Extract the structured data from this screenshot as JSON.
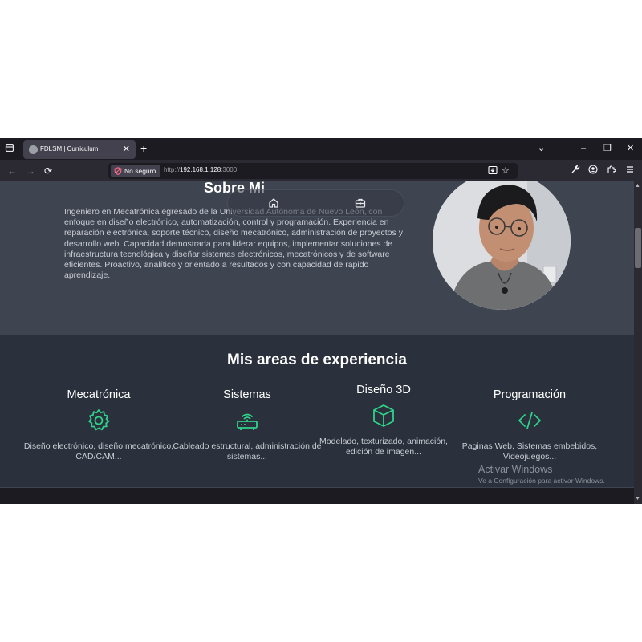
{
  "browser": {
    "tab": {
      "title": "FDLSM | Curriculum",
      "close": "✕"
    },
    "new_tab": "+",
    "window_controls": {
      "list_tabs": "⌄",
      "minimize": "–",
      "restore": "❐",
      "close": "✕"
    },
    "nav": {
      "back": "←",
      "forward": "→",
      "reload": "⟳"
    },
    "security_label": "No seguro",
    "url": {
      "scheme": "http://",
      "host": "192.168.1.128",
      "port": ":3000"
    },
    "toolbar_icons": [
      "reader-view-icon",
      "bookmark-star-icon",
      "tools-icon",
      "account-icon",
      "extensions-icon",
      "menu-icon"
    ]
  },
  "about": {
    "title": "Sobre Mi",
    "description": "Ingeniero en Mecatrónica egresado de la Universidad Autónoma de Nuevo León, con enfoque en diseño electrónico, automatización, control y programación. Experiencia en reparación electrónica, soporte técnico, diseño mecatrónico, administración de proyectos y desarrollo web. Capacidad demostrada para liderar equipos, implementar soluciones de infraestructura tecnológica y diseñar sistemas electrónicos, mecatrónicos y de software eficientes. Proactivo, analítico y orientado a resultados y con capacidad de rapido aprendizaje."
  },
  "areas": {
    "title": "Mis areas de experiencia",
    "items": [
      {
        "title": "Mecatrónica",
        "desc": "Diseño electrónico, diseño mecatrónico, CAD/CAM...",
        "icon": "gear-icon"
      },
      {
        "title": "Sistemas",
        "desc": "Cableado estructural, administración de sistemas...",
        "icon": "router-icon"
      },
      {
        "title": "Diseño 3D",
        "desc": "Modelado, texturizado, animación, edición de imagen...",
        "icon": "cube-icon"
      },
      {
        "title": "Programación",
        "desc": "Paginas Web, Sistemas embebidos, Videojuegos...",
        "icon": "code-icon"
      }
    ]
  },
  "watermark": {
    "title": "Activar Windows",
    "subtitle": "Ve a Configuración para activar Windows."
  },
  "colors": {
    "accent": "#2fd28a",
    "about_bg": "#3f4451",
    "areas_bg": "#2a303c",
    "browser_bg": "#1c1b22"
  }
}
